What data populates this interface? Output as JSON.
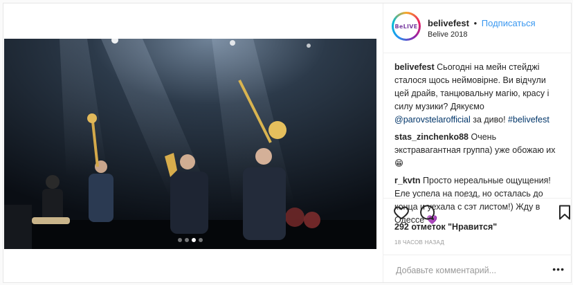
{
  "post": {
    "username": "belivefest",
    "separator": "•",
    "follow_label": "Подписаться",
    "location": "Belive 2018",
    "avatar_text": "BeLIVE",
    "image_dots": 4,
    "active_dot": 2,
    "image_alt": "Музыканты с трубами и тромбоном на сцене"
  },
  "comments": [
    {
      "user": "belivefest",
      "text": "Сьогодні на мейн стейджі сталося щось неймовірне. Ви відчули цей драйв, танцювальну магію, красу і силу музики? Дякуємо ",
      "mention": "@parovstelarofficial",
      "text2": " за диво! ",
      "hashtag": "#belivefest"
    },
    {
      "user": "stas_zinchenko88",
      "text": "Очень экстравагантная группа) уже обожаю их😁"
    },
    {
      "user": "r_kvtn",
      "text": "Просто нереальные ощущения! Еле успела на поезд, но осталась до конца и уехала с сэт листом!) Жду в Одессе 💜"
    }
  ],
  "load_more": "• • •",
  "actions": {
    "likes": "292 отметок \"Нравится\"",
    "time": "18 ЧАСОВ НАЗАД"
  },
  "add_comment": {
    "placeholder": "Добавьте комментарий...",
    "more": "•••"
  },
  "colors": {
    "link": "#003569",
    "follow": "#3897f0",
    "border": "#efefef"
  }
}
